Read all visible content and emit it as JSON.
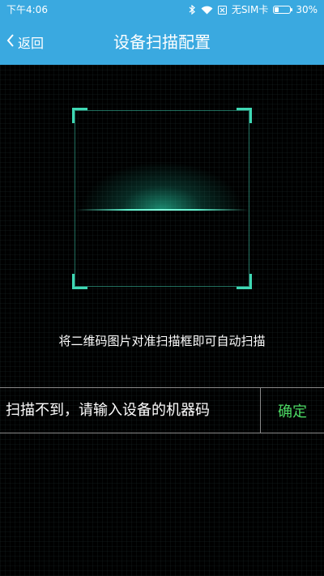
{
  "status_bar": {
    "time": "下午4:06",
    "carrier": "无SIM卡",
    "battery_percent": "30%",
    "battery_level": 0.3,
    "icons": [
      "bluetooth-icon",
      "wifi-icon",
      "no-sim-icon",
      "battery-icon"
    ]
  },
  "nav": {
    "back_label": "返回",
    "title": "设备扫描配置"
  },
  "scanner": {
    "hint": "将二维码图片对准扫描框即可自动扫描"
  },
  "manual_entry": {
    "placeholder": "扫描不到，请输入设备的机器码",
    "value": "",
    "confirm_label": "确定"
  },
  "colors": {
    "accent": "#3aa9e0",
    "scan": "#3fd8b4",
    "confirm": "#4cd964"
  }
}
